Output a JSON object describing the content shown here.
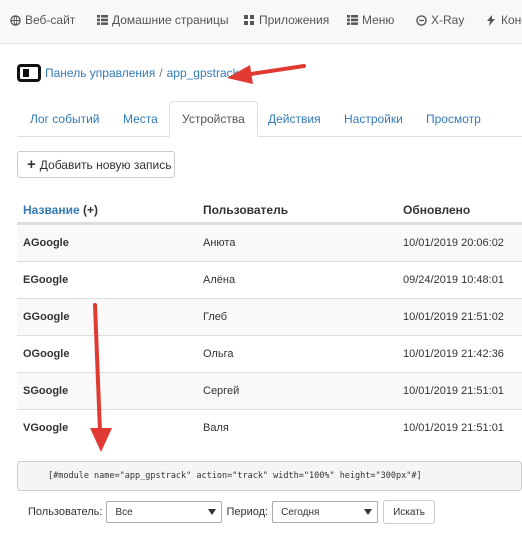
{
  "topnav": {
    "items": [
      {
        "label": "Веб-сайт",
        "icon": "globe-icon"
      },
      {
        "label": "Домашние страницы",
        "icon": "list-icon"
      },
      {
        "label": "Приложения",
        "icon": "grid-icon"
      },
      {
        "label": "Меню",
        "icon": "menu-icon"
      },
      {
        "label": "X-Ray",
        "icon": "xray-icon"
      },
      {
        "label": "Конс",
        "icon": "bolt-icon"
      }
    ]
  },
  "breadcrumb": {
    "root": "Панель управления",
    "separator": "/",
    "current": "app_gpstrack"
  },
  "tabs": [
    "Лог событий",
    "Места",
    "Устройства",
    "Действия",
    "Настройки",
    "Просмотр"
  ],
  "add_button": {
    "label": "Добавить новую запись"
  },
  "table": {
    "headers": {
      "name": "Название",
      "name_suffix": "(+)",
      "user": "Пользователь",
      "updated": "Обновлено"
    },
    "rows": [
      {
        "name": "AGoogle",
        "user": "Анюта",
        "updated": "10/01/2019 20:06:02"
      },
      {
        "name": "EGoogle",
        "user": "Алёна",
        "updated": "09/24/2019 10:48:01"
      },
      {
        "name": "GGoogle",
        "user": "Глеб",
        "updated": "10/01/2019 21:51:02"
      },
      {
        "name": "OGoogle",
        "user": "Ольга",
        "updated": "10/01/2019 21:42:36"
      },
      {
        "name": "SGoogle",
        "user": "Сергей",
        "updated": "10/01/2019 21:51:01"
      },
      {
        "name": "VGoogle",
        "user": "Валя",
        "updated": "10/01/2019 21:51:01"
      }
    ]
  },
  "code": "[#module name=\"app_gpstrack\" action=\"track\" width=\"100%\" height=\"300px\"#]",
  "filters": {
    "user_label": "Пользователь:",
    "user_value": "Все",
    "period_label": "Период:",
    "period_value": "Сегодня",
    "search_label": "Искать"
  },
  "colors": {
    "link": "#337ab7",
    "annotation_arrow": "#e03a32"
  }
}
